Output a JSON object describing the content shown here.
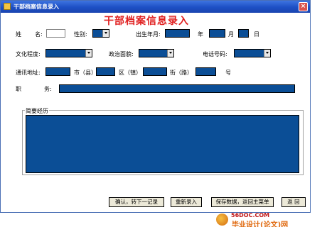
{
  "window": {
    "title": "干部档案信息录入",
    "close_glyph": "×"
  },
  "form": {
    "heading": "干部档案信息录入",
    "labels": {
      "name_a": "姓",
      "name_b": "名:",
      "gender": "性别:",
      "birth": "出生年月:",
      "year": "年",
      "month": "月",
      "day": "日",
      "education": "文化程度:",
      "political": "政治面貌:",
      "phone": "电话号码:",
      "address": "通讯地址:",
      "city": "市（县）",
      "district": "区（镇）",
      "street": "街（路）",
      "number": "号",
      "post_a": "职",
      "post_b": "务:"
    },
    "resume_label": "简要经历"
  },
  "buttons": {
    "confirm": "确认，转下一记录",
    "reenter": "重新录入",
    "save_return": "保存数据，返回主菜单",
    "back": "返 回"
  },
  "banner": {
    "url": "56DOC.COM",
    "text": "毕业设计(论文)网"
  },
  "colors": {
    "field_blue": "#0b4e96",
    "title_red": "#e02020",
    "titlebar_blue": "#1d4fc4"
  }
}
